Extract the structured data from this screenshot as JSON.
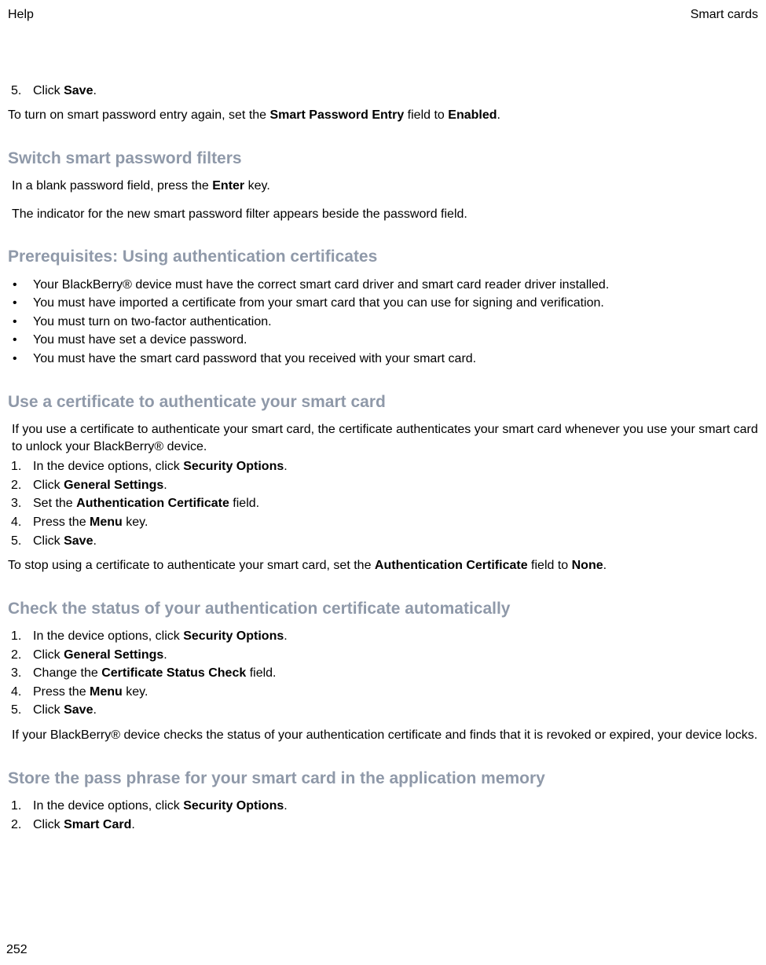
{
  "header": {
    "left": "Help",
    "right": "Smart cards"
  },
  "footer": {
    "page": "252"
  },
  "step5": {
    "num": "5.",
    "pre": "Click ",
    "bold": "Save",
    "post": "."
  },
  "turn_on_again": {
    "pre": "To turn on smart password entry again, set the ",
    "b1": "Smart Password Entry",
    "mid": " field to ",
    "b2": "Enabled",
    "post": "."
  },
  "switch_filters": {
    "title": "Switch smart password filters",
    "p1_pre": "In a blank password field, press the ",
    "p1_b": "Enter",
    "p1_post": " key.",
    "p2": "The indicator for the new smart password filter appears beside the password field."
  },
  "prereq": {
    "title": "Prerequisites: Using authentication certificates",
    "items": [
      "Your BlackBerry® device must have the correct smart card driver and smart card reader driver installed.",
      "You must have imported a certificate from your smart card that you can use for signing and verification.",
      "You must turn on two-factor authentication.",
      "You must have set a device password.",
      "You must have the smart card password that you received with your smart card."
    ]
  },
  "use_cert": {
    "title": "Use a certificate to authenticate your smart card",
    "intro": "If you use a certificate to authenticate your smart card, the certificate authenticates your smart card whenever you use your smart card to unlock your BlackBerry® device.",
    "steps": [
      {
        "num": "1.",
        "pre": "In the device options, click ",
        "b": "Security Options",
        "post": "."
      },
      {
        "num": "2.",
        "pre": "Click ",
        "b": "General Settings",
        "post": "."
      },
      {
        "num": "3.",
        "pre": "Set the ",
        "b": "Authentication Certificate",
        "post": " field."
      },
      {
        "num": "4.",
        "pre": "Press the ",
        "b": "Menu",
        "post": " key."
      },
      {
        "num": "5.",
        "pre": "Click ",
        "b": "Save",
        "post": "."
      }
    ],
    "outro": {
      "pre": "To stop using a certificate to authenticate your smart card, set the ",
      "b1": "Authentication Certificate",
      "mid": " field to ",
      "b2": "None",
      "post": "."
    }
  },
  "check_status": {
    "title": "Check the status of your authentication certificate automatically",
    "steps": [
      {
        "num": "1.",
        "pre": "In the device options, click ",
        "b": "Security Options",
        "post": "."
      },
      {
        "num": "2.",
        "pre": "Click ",
        "b": "General Settings",
        "post": "."
      },
      {
        "num": "3.",
        "pre": "Change the ",
        "b": "Certificate Status Check",
        "post": " field."
      },
      {
        "num": "4.",
        "pre": "Press the ",
        "b": "Menu",
        "post": " key."
      },
      {
        "num": "5.",
        "pre": "Click ",
        "b": "Save",
        "post": "."
      }
    ],
    "outro": "If your BlackBerry® device checks the status of your authentication certificate and finds that it is revoked or expired, your device locks."
  },
  "store_pass": {
    "title": "Store the pass phrase for your smart card in the application memory",
    "steps": [
      {
        "num": "1.",
        "pre": "In the device options, click ",
        "b": "Security Options",
        "post": "."
      },
      {
        "num": "2.",
        "pre": "Click ",
        "b": "Smart Card",
        "post": "."
      }
    ]
  }
}
